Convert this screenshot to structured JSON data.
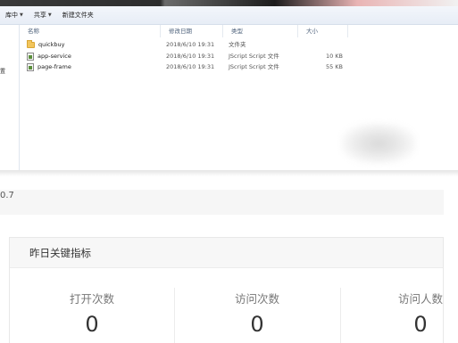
{
  "explorer": {
    "toolbar": {
      "items": [
        {
          "label": "库中"
        },
        {
          "label": "共享"
        },
        {
          "label": "新建文件夹"
        }
      ]
    },
    "nav": {
      "label": "置"
    },
    "columns": {
      "name": "名称",
      "date": "修改日期",
      "type": "类型",
      "size": "大小"
    },
    "files": [
      {
        "name": "quickbuy",
        "date": "2018/6/10 19:31",
        "type": "文件夹",
        "size": "",
        "icon": "folder-icon"
      },
      {
        "name": "app-service",
        "date": "2018/6/10 19:31",
        "type": "JScript Script 文件",
        "size": "10 KB",
        "icon": "js-file-icon"
      },
      {
        "name": "page-frame",
        "date": "2018/6/10 19:31",
        "type": "JScript Script 文件",
        "size": "55 KB",
        "icon": "js-file-icon"
      }
    ]
  },
  "version": {
    "text": "0.7"
  },
  "metrics": {
    "title": "昨日关键指标",
    "items": [
      {
        "label": "打开次数",
        "value": "0"
      },
      {
        "label": "访问次数",
        "value": "0"
      },
      {
        "label": "访问人数",
        "value": "0"
      }
    ]
  },
  "colors": {
    "folder": "#f2c55c",
    "toolbar_bg": "#e7edf6",
    "panel_header_bg": "#f7f7f7",
    "metric_label": "#777777",
    "metric_value": "#333333"
  }
}
